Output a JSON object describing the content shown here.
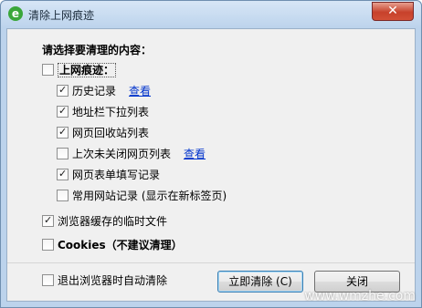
{
  "window": {
    "title": "清除上网痕迹",
    "close_glyph": "✕"
  },
  "heading": "请选择要清理的内容：",
  "group_main": {
    "label": "上网痕迹：",
    "checked": false
  },
  "items": [
    {
      "label": "历史记录",
      "checked": true,
      "link": "查看"
    },
    {
      "label": "地址栏下拉列表",
      "checked": true
    },
    {
      "label": "网页回收站列表",
      "checked": true
    },
    {
      "label": "上次未关闭网页列表",
      "checked": false,
      "link": "查看"
    },
    {
      "label": "网页表单填写记录",
      "checked": true
    },
    {
      "label": "常用网站记录 (显示在新标签页)",
      "checked": false
    }
  ],
  "temp_files": {
    "label": "浏览器缓存的临时文件",
    "checked": true
  },
  "cookies": {
    "label": "Cookies（不建议清理）",
    "checked": false
  },
  "auto_clear": {
    "label": "退出浏览器时自动清除",
    "checked": false
  },
  "buttons": {
    "clear_now": "立即清除 (C)",
    "close": "关闭"
  },
  "watermark": "www.wmzhe.com"
}
